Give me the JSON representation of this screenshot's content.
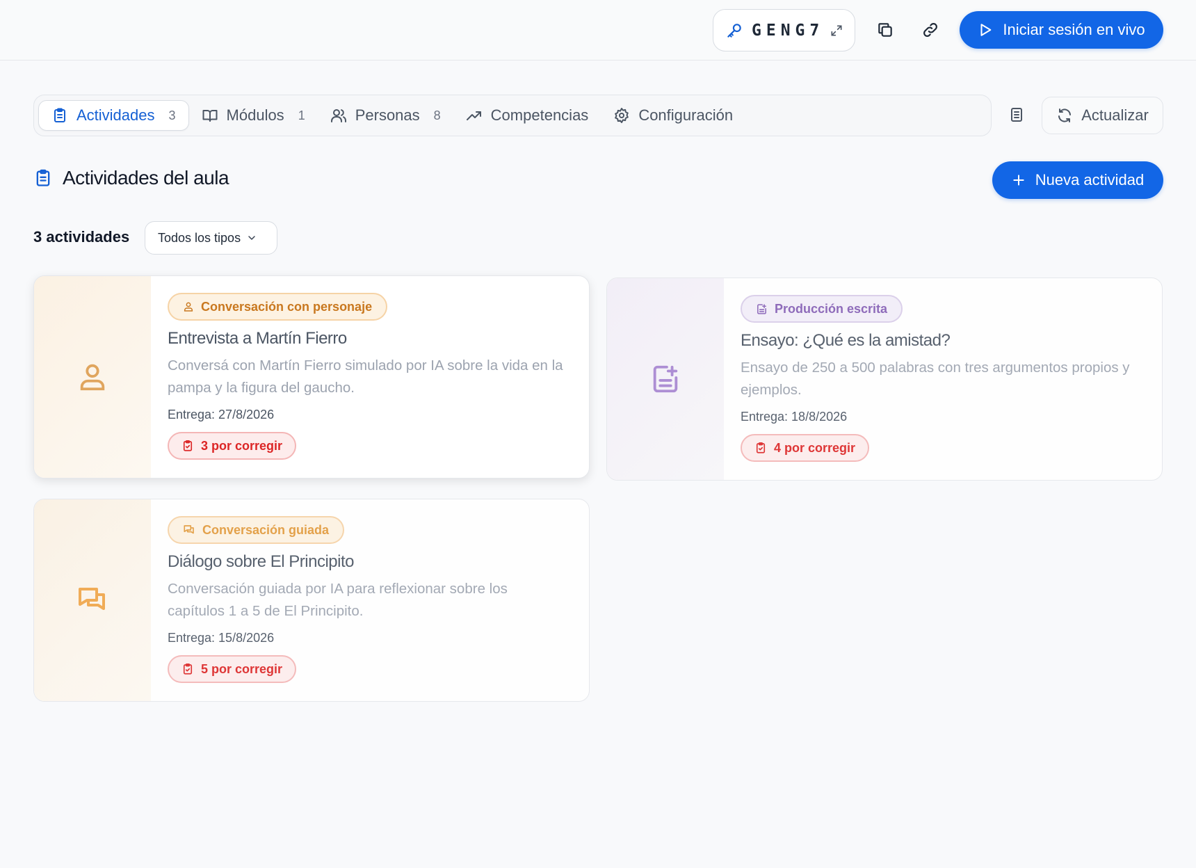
{
  "header": {
    "code": "GENG7",
    "live_button": "Iniciar sesión en vivo"
  },
  "tabs": [
    {
      "label": "Actividades",
      "count": "3",
      "icon": "clipboard-icon",
      "active": true
    },
    {
      "label": "Módulos",
      "count": "1",
      "icon": "book-icon"
    },
    {
      "label": "Personas",
      "count": "8",
      "icon": "users-icon"
    },
    {
      "label": "Competencias",
      "count": "",
      "icon": "trending-up-icon"
    },
    {
      "label": "Configuración",
      "count": "",
      "icon": "gear-icon"
    }
  ],
  "toolbar": {
    "refresh_label": "Actualizar"
  },
  "section": {
    "title": "Actividades del aula",
    "new_button": "Nueva actividad",
    "count_label": "3 actividades",
    "filter_value": "Todos los tipos"
  },
  "activities": [
    {
      "type": "Conversación con personaje",
      "title": "Entrevista a Martín Fierro",
      "description": "Conversá con Martín Fierro simulado por IA sobre la vida en la pampa y la figura del gaucho.",
      "due": "Entrega: 27/8/2026",
      "pending": "3 por corregir",
      "accent": "#e0a55e"
    },
    {
      "type": "Producción escrita",
      "title": "Ensayo: ¿Qué es la amistad?",
      "description": "Ensayo de 250 a 500 palabras con tres argumentos propios y ejemplos.",
      "due": "Entrega: 18/8/2026",
      "pending": "4 por corregir",
      "accent": "#a786d1"
    },
    {
      "type": "Conversación guiada",
      "title": "Diálogo sobre El Principito",
      "description": "Conversación guiada por IA para reflexionar sobre los capítulos 1 a 5 de El Principito.",
      "due": "Entrega: 15/8/2026",
      "pending": "5 por corregir",
      "accent": "#f0a64a"
    }
  ],
  "colors": {
    "primary": "#1266e6",
    "danger": "#dc2626",
    "orange": "#c9781f",
    "purple": "#8660b5"
  }
}
